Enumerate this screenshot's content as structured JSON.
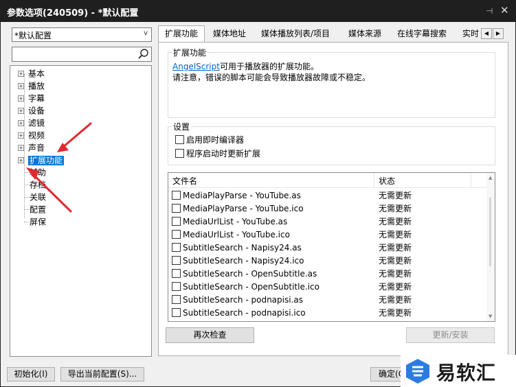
{
  "window": {
    "title": "参数选项(240509) - *默认配置",
    "pin_glyph": "⊣",
    "close_glyph": "✕"
  },
  "profile": {
    "selected": "*默认配置",
    "arrow": "v"
  },
  "search": {
    "value": "",
    "placeholder": ""
  },
  "tree": {
    "items": [
      {
        "label": "基本",
        "expander": "+"
      },
      {
        "label": "播放",
        "expander": "+"
      },
      {
        "label": "字幕",
        "expander": "+"
      },
      {
        "label": "设备",
        "expander": "+"
      },
      {
        "label": "滤镜",
        "expander": "+"
      },
      {
        "label": "视频",
        "expander": "+"
      },
      {
        "label": "声音",
        "expander": "+"
      },
      {
        "label": "扩展功能",
        "expander": "+"
      },
      {
        "label": "辅助"
      },
      {
        "label": "存档"
      },
      {
        "label": "关联"
      },
      {
        "label": "配置"
      },
      {
        "label": "屏保"
      }
    ],
    "selected": "扩展功能"
  },
  "tabs": {
    "items": [
      "扩展功能",
      "媒体地址",
      "媒体播放列表/项目",
      "媒体来源",
      "在线字幕搜索",
      "实时"
    ],
    "active": "扩展功能",
    "scroll_left": "◀",
    "scroll_right": "▶"
  },
  "extension_group": {
    "title": "扩展功能",
    "link_text": "AngelScript",
    "line1_rest": "可用于播放器的扩展功能。",
    "line2": "请注意，错误的脚本可能会导致播放器故障或不稳定。"
  },
  "settings_group": {
    "title": "设置",
    "options": [
      {
        "label": "启用即时编译器",
        "checked": false
      },
      {
        "label": "程序启动时更新扩展",
        "checked": false
      }
    ]
  },
  "file_list": {
    "columns": [
      "文件名",
      "状态"
    ],
    "rows": [
      {
        "file": "MediaPlayParse - YouTube.as",
        "status": "无需更新"
      },
      {
        "file": "MediaPlayParse - YouTube.ico",
        "status": "无需更新"
      },
      {
        "file": "MediaUrlList - YouTube.as",
        "status": "无需更新"
      },
      {
        "file": "MediaUrlList - YouTube.ico",
        "status": "无需更新"
      },
      {
        "file": "SubtitleSearch - Napisy24.as",
        "status": "无需更新"
      },
      {
        "file": "SubtitleSearch - Napisy24.ico",
        "status": "无需更新"
      },
      {
        "file": "SubtitleSearch - OpenSubtitle.as",
        "status": "无需更新"
      },
      {
        "file": "SubtitleSearch - OpenSubtitle.ico",
        "status": "无需更新"
      },
      {
        "file": "SubtitleSearch - podnapisi.as",
        "status": "无需更新"
      },
      {
        "file": "SubtitleSearch - podnapisi.ico",
        "status": "无需更新"
      }
    ],
    "scroll_up": "▲",
    "scroll_down": "▼"
  },
  "buttons": {
    "recheck": "再次检查",
    "update_install": "更新/安装",
    "initialize": "初始化(I)",
    "export_config": "导出当前配置(S)...",
    "ok": "确定(O)"
  },
  "watermark": {
    "text": "易软汇"
  },
  "colors": {
    "selection": "#0078d7",
    "link": "#0066cc",
    "arrow": "#e0282f",
    "watermark_blue": "#2e7be0"
  }
}
